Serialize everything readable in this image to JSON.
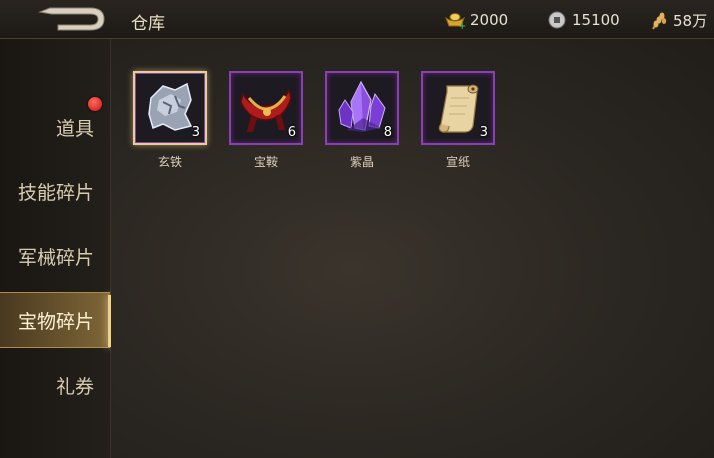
{
  "header": {
    "title": "仓库",
    "currencies": [
      {
        "name": "gold-ingot-icon",
        "value": "2000"
      },
      {
        "name": "coin-icon",
        "value": "15100"
      },
      {
        "name": "grain-icon",
        "value": "58万"
      }
    ]
  },
  "sidebar": {
    "items": [
      {
        "label": "道具",
        "has_badge": true
      },
      {
        "label": "技能碎片"
      },
      {
        "label": "军械碎片"
      },
      {
        "label": "宝物碎片",
        "active": true
      },
      {
        "label": "礼券"
      }
    ]
  },
  "inventory": {
    "items": [
      {
        "name": "玄铁",
        "count": "3",
        "icon": "iron-ore-icon",
        "selected": true
      },
      {
        "name": "宝鞍",
        "count": "6",
        "icon": "saddle-icon"
      },
      {
        "name": "紫晶",
        "count": "8",
        "icon": "purple-crystal-icon"
      },
      {
        "name": "宣纸",
        "count": "3",
        "icon": "paper-scroll-icon"
      }
    ]
  },
  "colors": {
    "rarity_border": "#8a3fb6",
    "selected_border": "#e8d28a",
    "badge": "#d10f0f"
  }
}
